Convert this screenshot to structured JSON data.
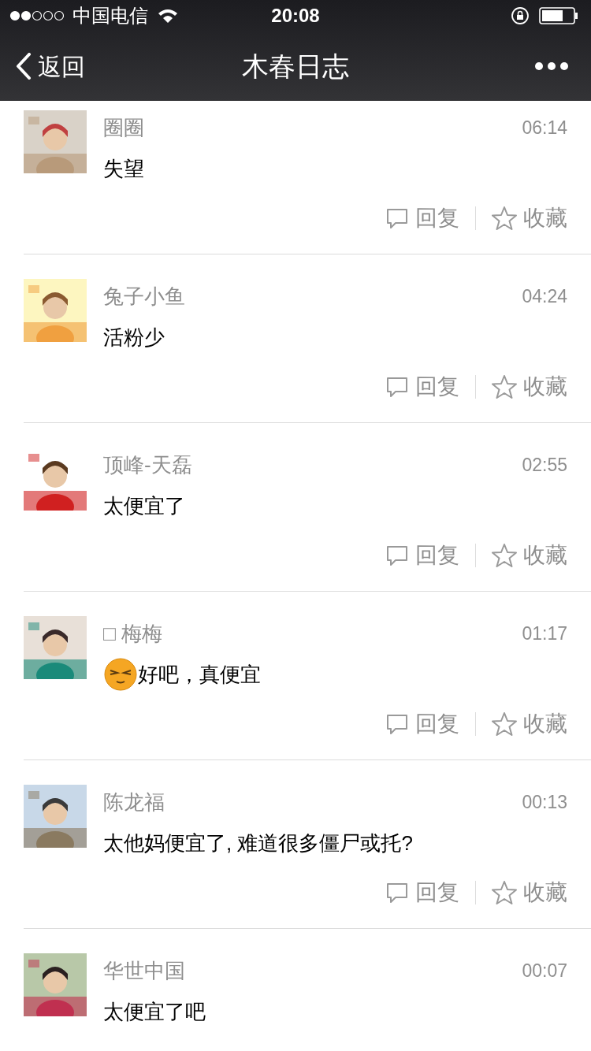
{
  "status_bar": {
    "carrier": "中国电信",
    "time": "20:08"
  },
  "nav": {
    "back": "返回",
    "title": "木春日志"
  },
  "comments": [
    {
      "name": "圈圈",
      "time": "06:14",
      "text": "失望",
      "emoji": false,
      "reply": "回复",
      "favorite": "收藏"
    },
    {
      "name": "兔子小鱼",
      "time": "04:24",
      "text": "活粉少",
      "emoji": false,
      "reply": "回复",
      "favorite": "收藏"
    },
    {
      "name": "顶峰-天磊",
      "time": "02:55",
      "text": "太便宜了",
      "emoji": false,
      "reply": "回复",
      "favorite": "收藏"
    },
    {
      "name": "□ 梅梅",
      "time": "01:17",
      "text": "好吧，真便宜",
      "emoji": true,
      "reply": "回复",
      "favorite": "收藏"
    },
    {
      "name": "陈龙福",
      "time": "00:13",
      "text": "太他妈便宜了, 难道很多僵尸或托?",
      "emoji": false,
      "reply": "回复",
      "favorite": "收藏"
    },
    {
      "name": "华世中国",
      "time": "00:07",
      "text": "太便宜了吧",
      "emoji": false
    }
  ]
}
